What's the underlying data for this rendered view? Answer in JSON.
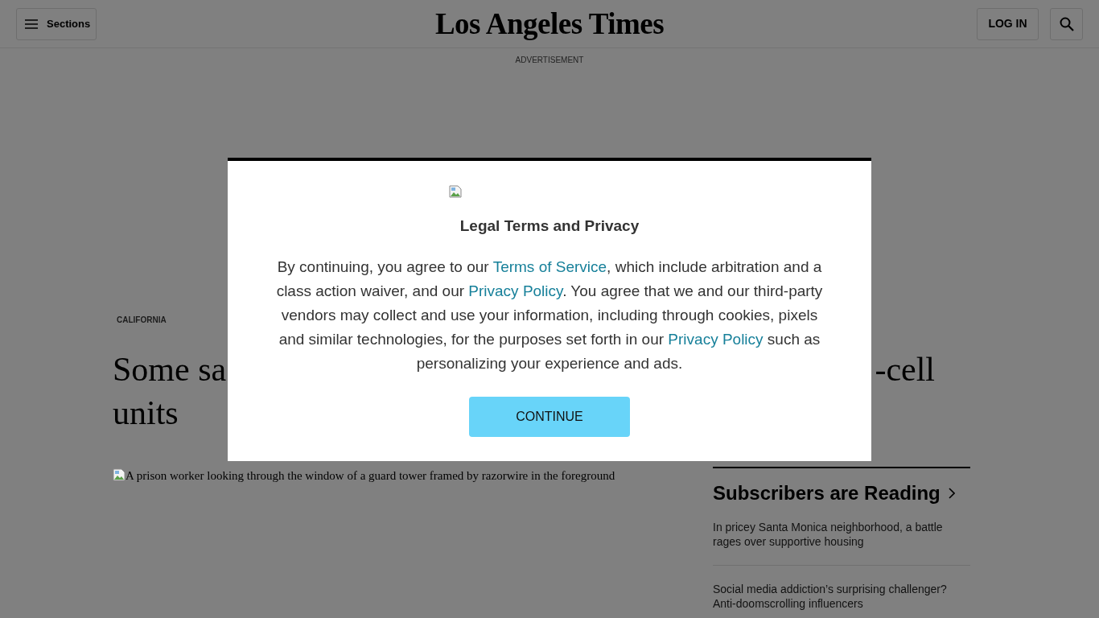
{
  "header": {
    "menu_button": "Sections",
    "logo": "Los Angeles Times",
    "login_button": "LOG IN"
  },
  "advertisement": {
    "label": "ADVERTISEMENT"
  },
  "article": {
    "section": "CALIFORNIA",
    "headline": {
      "line_1_left": "Some sa",
      "line_1_right": "-cell",
      "line_2": "units"
    },
    "image_alt": "A prison worker looking through the window of a guard tower framed by razorwire in the foreground"
  },
  "sidebar": {
    "title": "Subscribers are Reading",
    "items": [
      "In pricey Santa Monica neighborhood, a battle rages over supportive housing",
      "Social media addiction’s surprising challenger? Anti-doomscrolling influencers"
    ]
  },
  "modal": {
    "title": "Legal Terms and Privacy",
    "body": [
      {
        "kind": "text",
        "text": "By continuing, you agree to our "
      },
      {
        "kind": "link",
        "text": "Terms of Service"
      },
      {
        "kind": "text",
        "text": ", which include arbitration and a class action waiver, and our "
      },
      {
        "kind": "link",
        "text": "Privacy Policy"
      },
      {
        "kind": "text",
        "text": ". You agree that we and our third-party vendors may collect and use your information, including through cookies, pixels and similar technologies, for the purposes set forth in our "
      },
      {
        "kind": "link",
        "text": "Privacy Policy"
      },
      {
        "kind": "text",
        "text": " such as personalizing your experience and ads."
      }
    ],
    "button": "CONTINUE"
  }
}
